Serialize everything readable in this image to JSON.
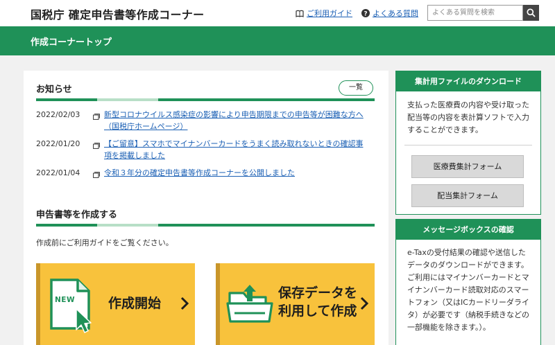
{
  "header": {
    "site_title": "国税庁 確定申告書等作成コーナー",
    "guide_link": "ご利用ガイド",
    "faq_link": "よくある質問",
    "search_placeholder": "よくある質問を検索"
  },
  "banner": {
    "title": "作成コーナートップ"
  },
  "news": {
    "heading": "お知らせ",
    "list_button": "一覧",
    "items": [
      {
        "date": "2022/02/03",
        "text": "新型コロナウイルス感染症の影響により申告期限までの申告等が困難な方へ（国税庁ホームページ）"
      },
      {
        "date": "2022/01/20",
        "text": "【ご留意】スマホでマイナンバーカードをうまく読み取れないときの確認事項を掲載しました"
      },
      {
        "date": "2022/01/04",
        "text": "令和３年分の確定申告書等作成コーナーを公開しました"
      }
    ]
  },
  "create": {
    "heading": "申告書等を作成する",
    "lead": "作成前にご利用ガイドをご覧ください。",
    "new_button_label": "作成開始",
    "new_badge": "NEW",
    "saved_button_line1": "保存データを",
    "saved_button_line2": "利用して作成"
  },
  "sidebar": {
    "download": {
      "heading": "集計用ファイルのダウンロード",
      "text": "支払った医療費の内容や受け取った配当等の内容を表計算ソフトで入力することができます。",
      "buttons": [
        "医療費集計フォーム",
        "配当集計フォーム"
      ]
    },
    "message": {
      "heading": "メッセージボックスの確認",
      "text": "e-Taxの受付結果の確認や送信したデータのダウンロードができます。ご利用にはマイナンバーカードとマイナンバーカード読取対応のスマートフォン（又はICカードリーダライタ）が必要です（納税手続きなどの一部機能を除きます。）。"
    }
  },
  "colors": {
    "brand_green": "#1f9158",
    "button_yellow": "#f8c23c",
    "link_blue": "#1a5fb4"
  }
}
